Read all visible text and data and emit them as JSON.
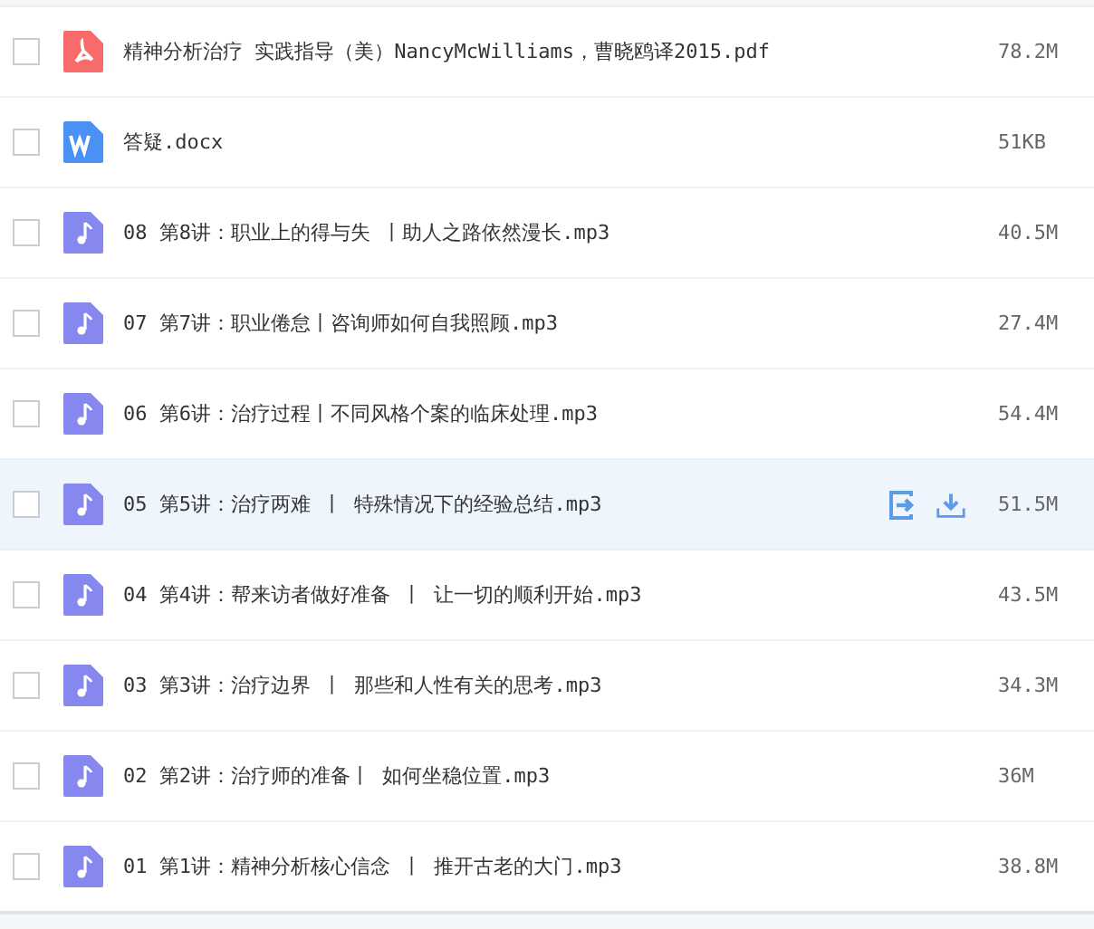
{
  "files": [
    {
      "kind": "pdf",
      "name": "精神分析治疗 实践指导（美）NancyMcWilliams，曹晓鸥译2015.pdf",
      "size": "78.2M",
      "checked": false,
      "highlighted": false
    },
    {
      "kind": "word",
      "name": "答疑.docx",
      "size": "51KB",
      "checked": false,
      "highlighted": false
    },
    {
      "kind": "audio",
      "name": "08 第8讲：职业上的得与失 丨助人之路依然漫长.mp3",
      "size": "40.5M",
      "checked": false,
      "highlighted": false
    },
    {
      "kind": "audio",
      "name": "07 第7讲：职业倦怠丨咨询师如何自我照顾.mp3",
      "size": "27.4M",
      "checked": false,
      "highlighted": false
    },
    {
      "kind": "audio",
      "name": "06 第6讲：治疗过程丨不同风格个案的临床处理.mp3",
      "size": "54.4M",
      "checked": false,
      "highlighted": false
    },
    {
      "kind": "audio",
      "name": "05 第5讲：治疗两难 丨 特殊情况下的经验总结.mp3",
      "size": "51.5M",
      "checked": false,
      "highlighted": true
    },
    {
      "kind": "audio",
      "name": "04 第4讲：帮来访者做好准备 丨 让一切的顺利开始.mp3",
      "size": "43.5M",
      "checked": false,
      "highlighted": false
    },
    {
      "kind": "audio",
      "name": "03 第3讲：治疗边界 丨 那些和人性有关的思考.mp3",
      "size": "34.3M",
      "checked": false,
      "highlighted": false
    },
    {
      "kind": "audio",
      "name": "02 第2讲：治疗师的准备丨 如何坐稳位置.mp3",
      "size": "36M",
      "checked": false,
      "highlighted": false
    },
    {
      "kind": "audio",
      "name": "01 第1讲：精神分析核心信念 丨 推开古老的大门.mp3",
      "size": "38.8M",
      "checked": false,
      "highlighted": false
    }
  ]
}
